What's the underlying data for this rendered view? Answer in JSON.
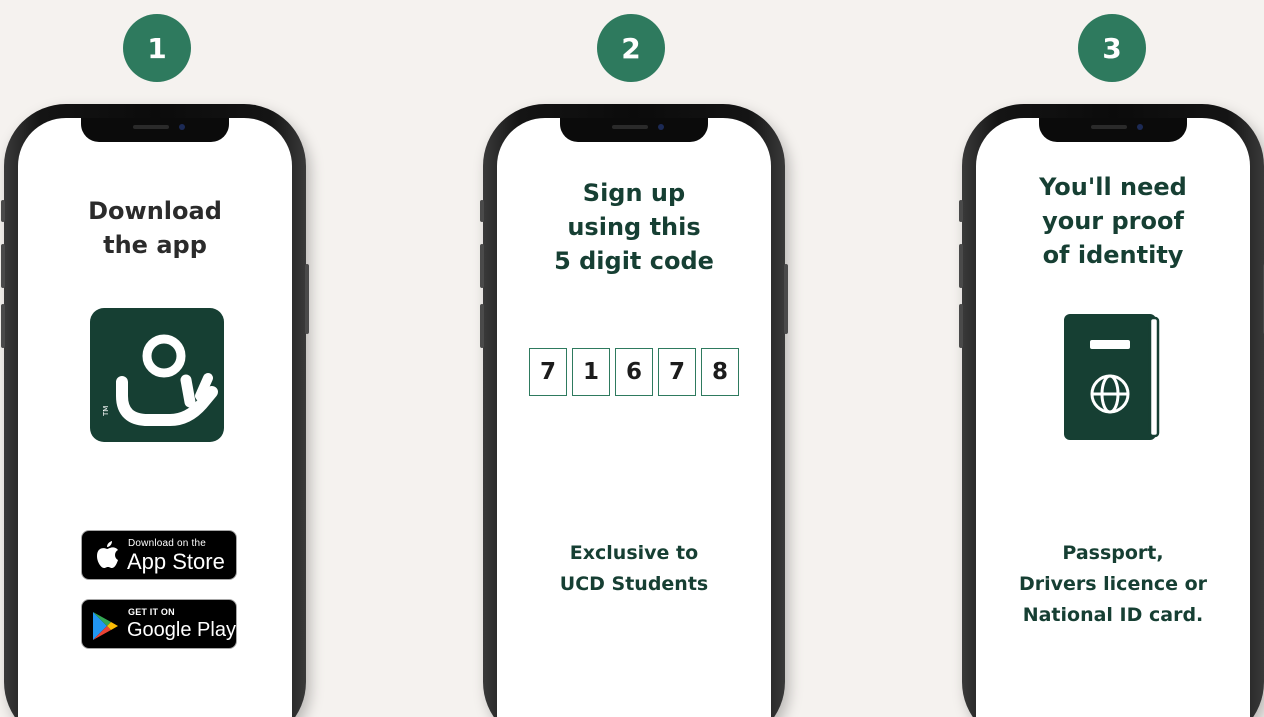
{
  "colors": {
    "background": "#f5f2ef",
    "badge": "#2e7a5e",
    "brand_dark_green": "#163f33"
  },
  "steps": [
    {
      "number": "1",
      "title": "Download\nthe app",
      "logo_icon": "app-logo-icon",
      "logo_mark": "TM",
      "app_store": {
        "small": "Download on the",
        "big": "App Store",
        "icon": "apple-icon"
      },
      "google_play": {
        "small": "GET IT ON",
        "big": "Google Play",
        "icon": "google-play-icon"
      }
    },
    {
      "number": "2",
      "title": "Sign up\nusing this\n5 digit code",
      "code_digits": [
        "7",
        "1",
        "6",
        "7",
        "8"
      ],
      "footer": "Exclusive to\nUCD Students"
    },
    {
      "number": "3",
      "title": "You'll need\nyour proof\nof identity",
      "icon": "passport-icon",
      "footer": "Passport,\nDrivers licence or\nNational ID card."
    }
  ]
}
